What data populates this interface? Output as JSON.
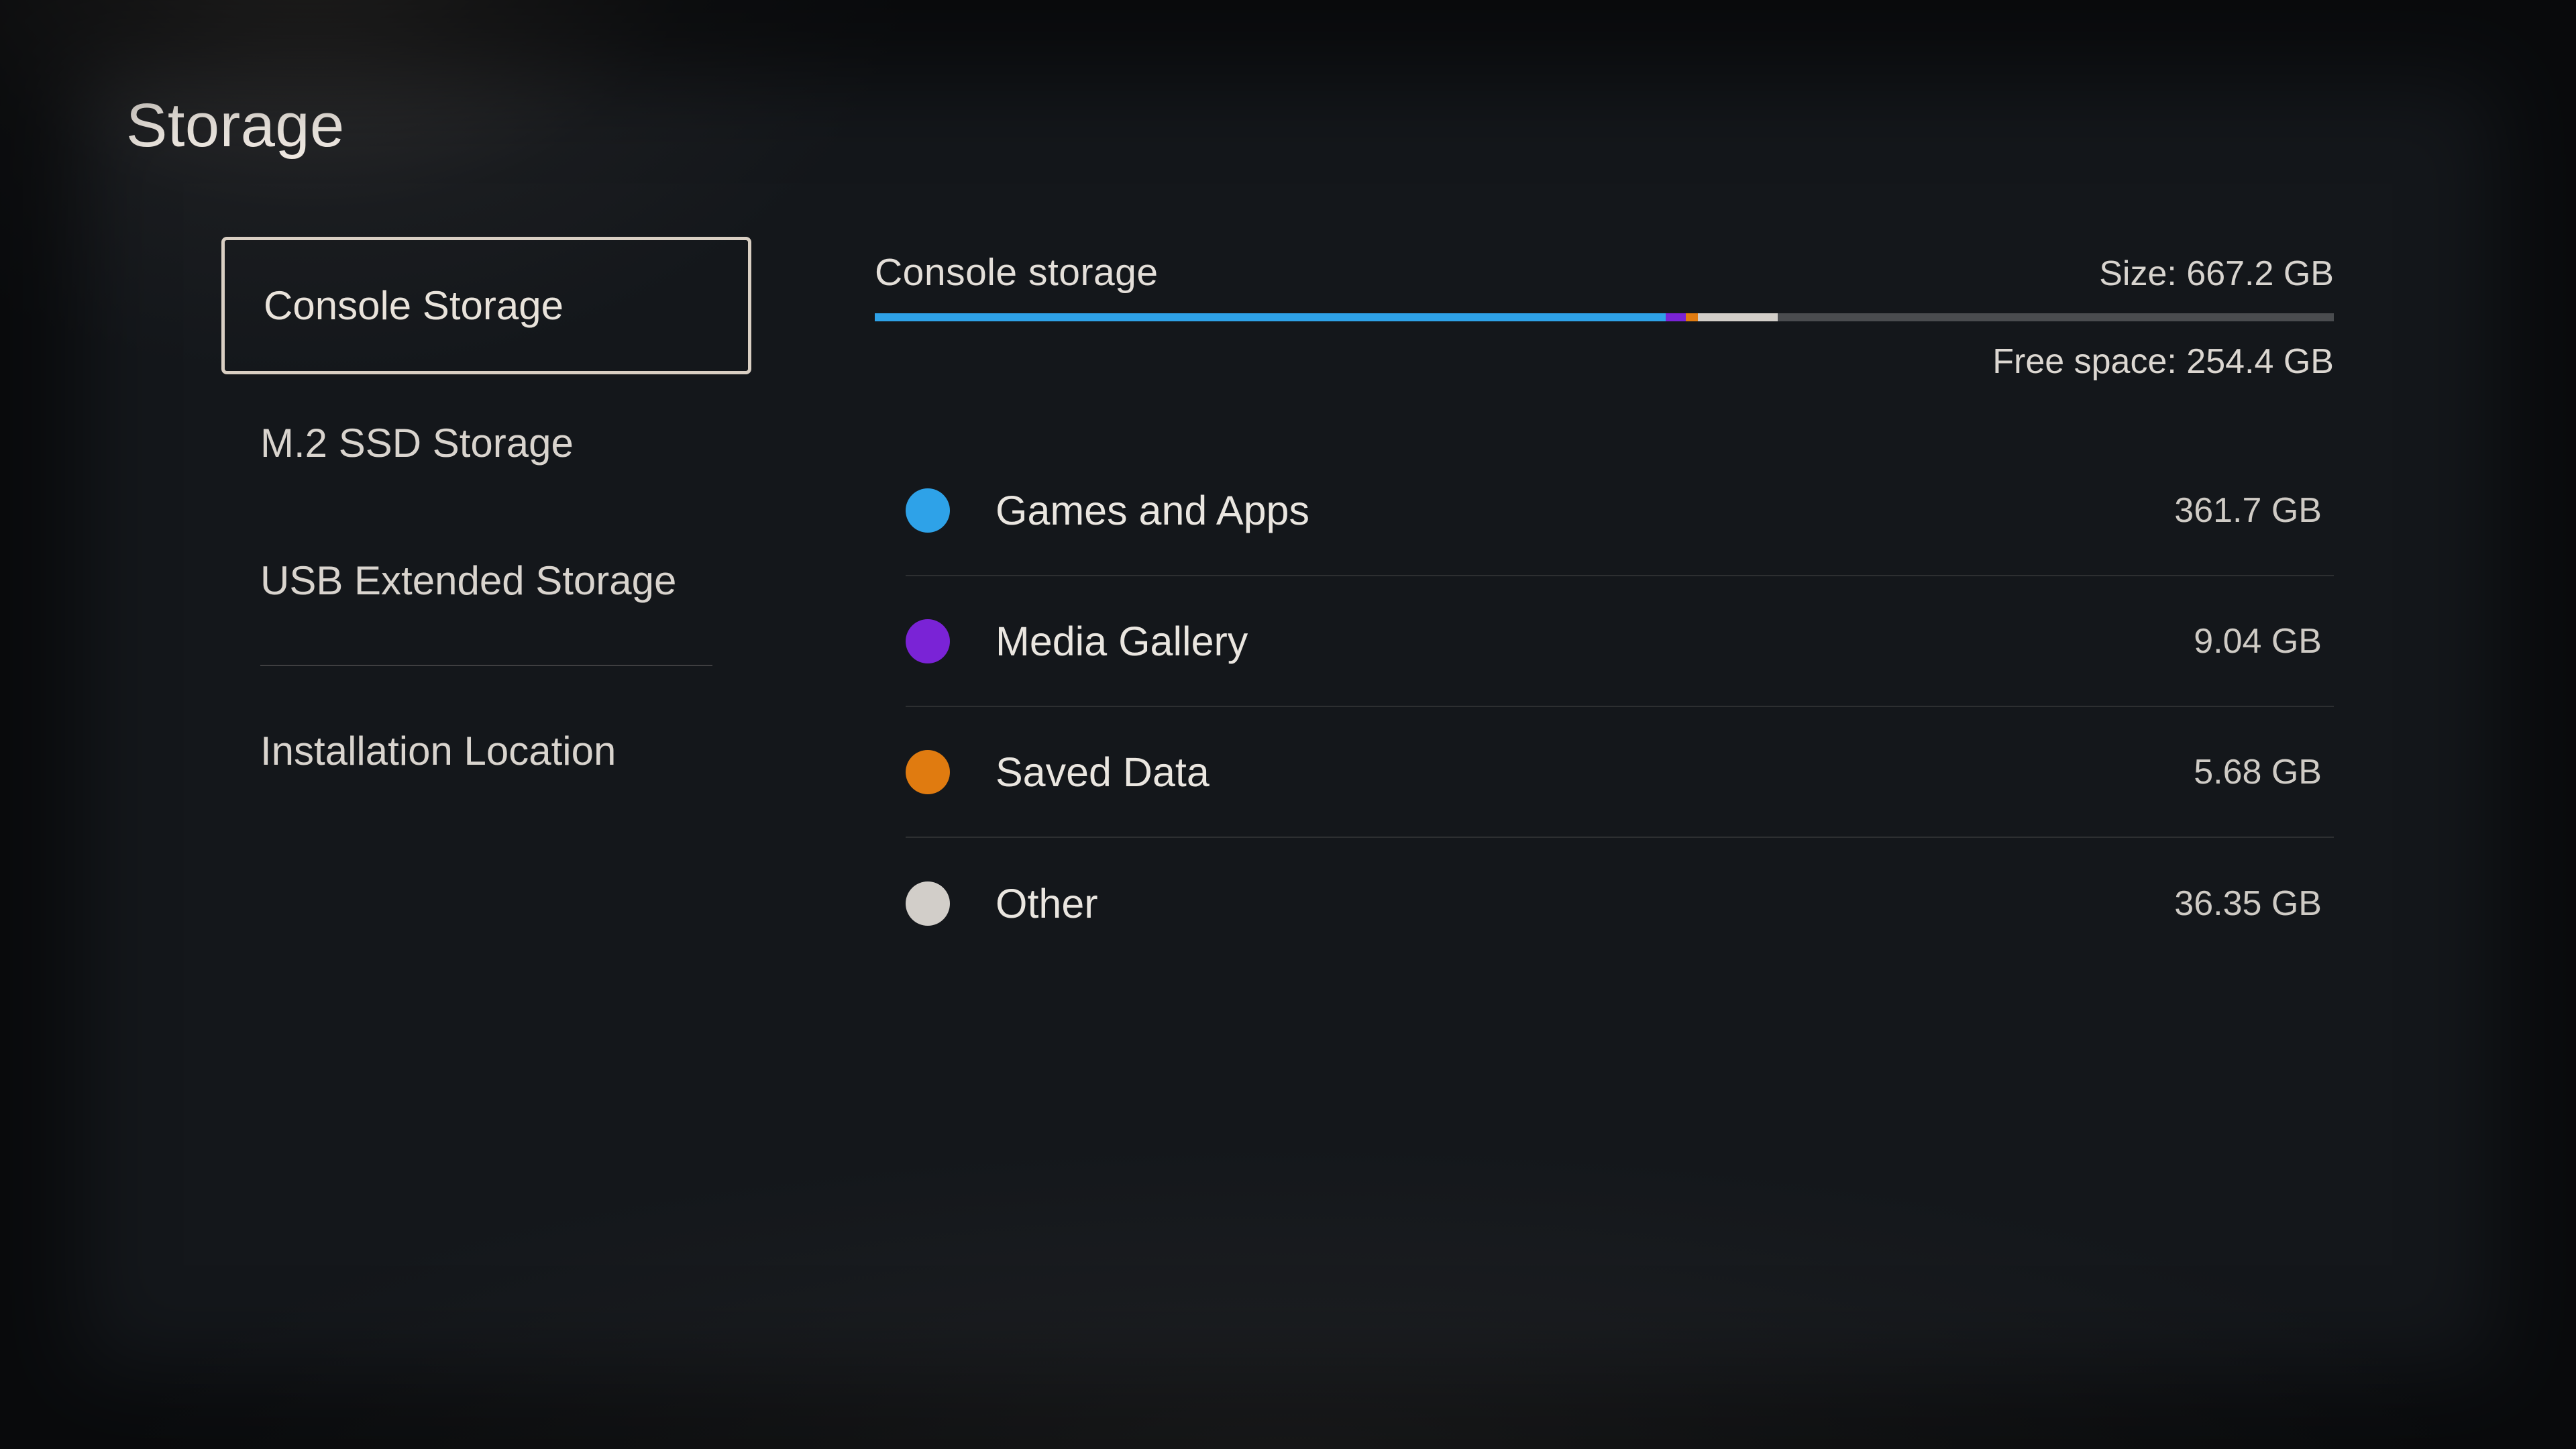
{
  "page_title": "Storage",
  "sidebar": {
    "items": [
      {
        "label": "Console Storage",
        "selected": true
      },
      {
        "label": "M.2 SSD Storage",
        "selected": false
      },
      {
        "label": "USB Extended Storage",
        "selected": false
      }
    ],
    "after_divider": [
      {
        "label": "Installation Location"
      }
    ]
  },
  "main": {
    "title": "Console storage",
    "size_label": "Size: 667.2 GB",
    "free_label": "Free space: 254.4 GB",
    "total_gb": 667.2,
    "free_gb": 254.4,
    "categories": [
      {
        "label": "Games and Apps",
        "value": "361.7 GB",
        "gb": 361.7,
        "color": "#2ea2e8"
      },
      {
        "label": "Media Gallery",
        "value": "9.04 GB",
        "gb": 9.04,
        "color": "#7a23d6"
      },
      {
        "label": "Saved Data",
        "value": "5.68 GB",
        "gb": 5.68,
        "color": "#e07b10"
      },
      {
        "label": "Other",
        "value": "36.35 GB",
        "gb": 36.35,
        "color": "#d2cec9"
      }
    ]
  }
}
